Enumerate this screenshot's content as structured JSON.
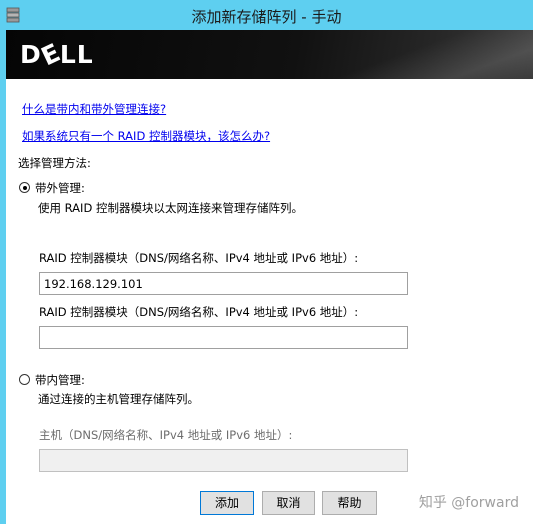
{
  "window": {
    "title": "添加新存储阵列 - 手动",
    "icon": "storage-array-icon"
  },
  "banner": {
    "logo": "DELL"
  },
  "links": {
    "inband_outband_help": "什么是带内和带外管理连接?",
    "single_controller_help": "如果系统只有一个 RAID 控制器模块，该怎么办?"
  },
  "method_label": "选择管理方法:",
  "out_of_band": {
    "label": "带外管理:",
    "selected": true,
    "description": "使用 RAID 控制器模块以太网连接来管理存储阵列。",
    "controller1_label": "RAID 控制器模块（DNS/网络名称、IPv4 地址或 IPv6 地址）:",
    "controller1_value": "192.168.129.101",
    "controller2_label": "RAID 控制器模块（DNS/网络名称、IPv4 地址或 IPv6 地址）:",
    "controller2_value": ""
  },
  "in_band": {
    "label": "带内管理:",
    "selected": false,
    "description": "通过连接的主机管理存储阵列。",
    "host_label": "主机（DNS/网络名称、IPv4 地址或 IPv6 地址）:",
    "host_value": ""
  },
  "buttons": {
    "add": "添加",
    "cancel": "取消",
    "help": "帮助"
  },
  "watermark": "知乎 @forward"
}
